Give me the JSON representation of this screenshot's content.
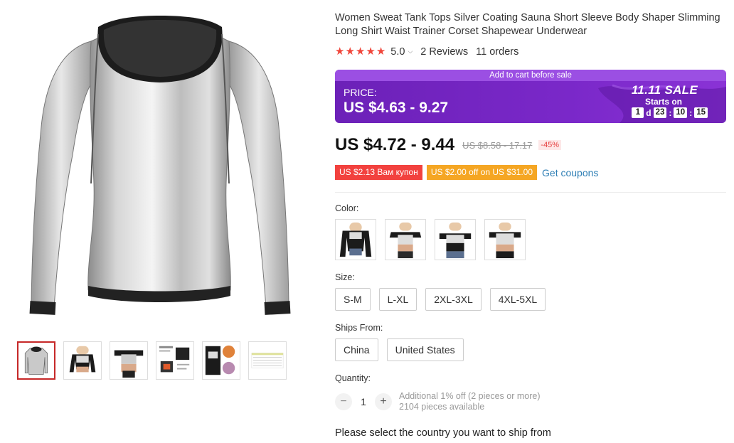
{
  "product": {
    "title": "Women Sweat Tank Tops Silver Coating Sauna Short Sleeve Body Shaper Slimming Long Shirt Waist Trainer Corset Shapewear Underwear",
    "rating_score": "5.0",
    "reviews": "2 Reviews",
    "orders": "11 orders"
  },
  "sale": {
    "banner": "Add to cart before sale",
    "price_label": "PRICE:",
    "price_range": "US $4.63 - 9.27",
    "sale_name": "11.11 SALE",
    "starts_on": "Starts on",
    "timer": {
      "days": "1",
      "days_unit": "d",
      "hours": "23",
      "minutes": "10",
      "seconds": "15",
      "sep": ":"
    }
  },
  "pricing": {
    "current": "US $4.72 - 9.44",
    "original": "US $8.58 - 17.17",
    "discount": "-45%"
  },
  "coupons": {
    "coupon1": "US $2.13 Вам купон",
    "coupon2": "US $2.00 off on US $31.00",
    "get_coupons": "Get coupons"
  },
  "color": {
    "label": "Color:"
  },
  "size": {
    "label": "Size:",
    "options": [
      "S-M",
      "L-XL",
      "2XL-3XL",
      "4XL-5XL"
    ]
  },
  "ships_from": {
    "label": "Ships From:",
    "options": [
      "China",
      "United States"
    ]
  },
  "quantity": {
    "label": "Quantity:",
    "minus": "−",
    "value": "1",
    "plus": "+",
    "note": "Additional 1% off (2 pieces or more)",
    "available": "2104 pieces available"
  },
  "ship_note": "Please select the country you want to ship from",
  "colors": {
    "star": "#f0463b",
    "sale_purple": "#7a28c9",
    "coupon_red": "#f2413e",
    "coupon_orange": "#f5a623",
    "link": "#2f7fb5"
  }
}
